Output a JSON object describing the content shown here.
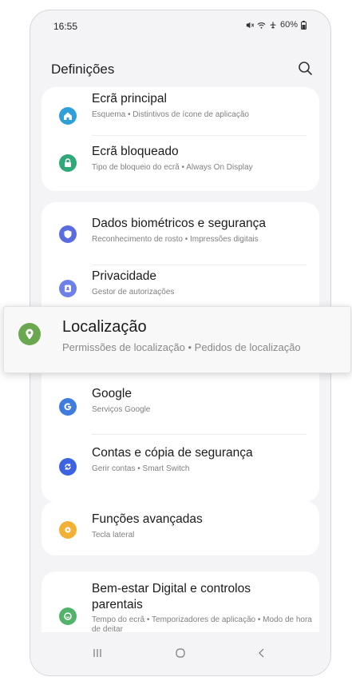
{
  "status_bar": {
    "time": "16:55",
    "icons": [
      "mute-icon",
      "wifi-icon",
      "airplane-icon"
    ],
    "battery": "60%"
  },
  "header": {
    "title": "Definições",
    "search_icon": "search-icon"
  },
  "colors": {
    "home": "#2f9fd8",
    "lock": "#2fa87a",
    "biometrics": "#5a6de0",
    "privacy": "#6d7fe8",
    "location": "#6aa84f",
    "google": "#3e7ce0",
    "accounts": "#3d64e0",
    "advanced": "#f2b035",
    "wellbeing": "#54b36b"
  },
  "items": {
    "home_screen": {
      "title": "Ecrã principal",
      "subtitle": "Esquema  •  Distintivos de ícone de aplicação",
      "icon": "home-icon"
    },
    "lock_screen": {
      "title": "Ecrã bloqueado",
      "subtitle": "Tipo de bloqueio do ecrã  •  Always On Display",
      "icon": "lock-icon"
    },
    "biometrics": {
      "title": "Dados biométricos e segurança",
      "subtitle": "Reconhecimento de rosto  •  Impressões digitais",
      "icon": "shield-icon"
    },
    "privacy": {
      "title": "Privacidade",
      "subtitle": "Gestor de autorizações",
      "icon": "privacy-icon"
    },
    "location": {
      "title": "Localização",
      "subtitle": "Permissões de localização  •  Pedidos de localização",
      "icon": "location-pin-icon"
    },
    "google": {
      "title": "Google",
      "subtitle": "Serviços Google",
      "icon": "google-icon"
    },
    "accounts": {
      "title": "Contas e cópia de segurança",
      "subtitle": "Gerir contas  •  Smart Switch",
      "icon": "sync-icon"
    },
    "advanced": {
      "title": "Funções avançadas",
      "subtitle": "Tecla lateral",
      "icon": "gear-icon"
    },
    "wellbeing": {
      "title": "Bem-estar Digital e controlos parentais",
      "subtitle": "Tempo do ecrã  •  Temporizadores de aplicação  •  Modo de hora de deitar",
      "icon": "wellbeing-icon"
    }
  },
  "nav": {
    "recents": "recents-icon",
    "home": "home-button-icon",
    "back": "back-icon"
  }
}
